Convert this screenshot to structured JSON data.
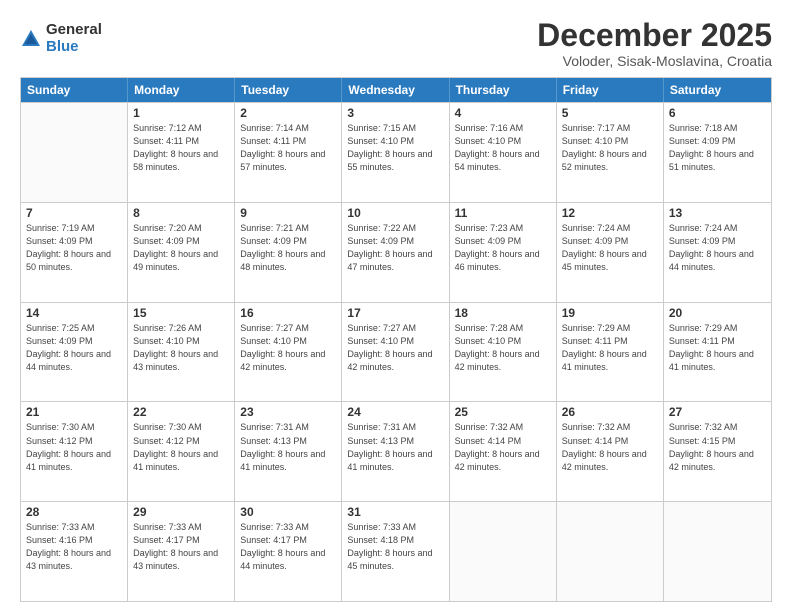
{
  "logo": {
    "general": "General",
    "blue": "Blue"
  },
  "title": "December 2025",
  "subtitle": "Voloder, Sisak-Moslavina, Croatia",
  "header_days": [
    "Sunday",
    "Monday",
    "Tuesday",
    "Wednesday",
    "Thursday",
    "Friday",
    "Saturday"
  ],
  "weeks": [
    [
      {
        "day": "",
        "sunrise": "",
        "sunset": "",
        "daylight": ""
      },
      {
        "day": "1",
        "sunrise": "Sunrise: 7:12 AM",
        "sunset": "Sunset: 4:11 PM",
        "daylight": "Daylight: 8 hours and 58 minutes."
      },
      {
        "day": "2",
        "sunrise": "Sunrise: 7:14 AM",
        "sunset": "Sunset: 4:11 PM",
        "daylight": "Daylight: 8 hours and 57 minutes."
      },
      {
        "day": "3",
        "sunrise": "Sunrise: 7:15 AM",
        "sunset": "Sunset: 4:10 PM",
        "daylight": "Daylight: 8 hours and 55 minutes."
      },
      {
        "day": "4",
        "sunrise": "Sunrise: 7:16 AM",
        "sunset": "Sunset: 4:10 PM",
        "daylight": "Daylight: 8 hours and 54 minutes."
      },
      {
        "day": "5",
        "sunrise": "Sunrise: 7:17 AM",
        "sunset": "Sunset: 4:10 PM",
        "daylight": "Daylight: 8 hours and 52 minutes."
      },
      {
        "day": "6",
        "sunrise": "Sunrise: 7:18 AM",
        "sunset": "Sunset: 4:09 PM",
        "daylight": "Daylight: 8 hours and 51 minutes."
      }
    ],
    [
      {
        "day": "7",
        "sunrise": "Sunrise: 7:19 AM",
        "sunset": "Sunset: 4:09 PM",
        "daylight": "Daylight: 8 hours and 50 minutes."
      },
      {
        "day": "8",
        "sunrise": "Sunrise: 7:20 AM",
        "sunset": "Sunset: 4:09 PM",
        "daylight": "Daylight: 8 hours and 49 minutes."
      },
      {
        "day": "9",
        "sunrise": "Sunrise: 7:21 AM",
        "sunset": "Sunset: 4:09 PM",
        "daylight": "Daylight: 8 hours and 48 minutes."
      },
      {
        "day": "10",
        "sunrise": "Sunrise: 7:22 AM",
        "sunset": "Sunset: 4:09 PM",
        "daylight": "Daylight: 8 hours and 47 minutes."
      },
      {
        "day": "11",
        "sunrise": "Sunrise: 7:23 AM",
        "sunset": "Sunset: 4:09 PM",
        "daylight": "Daylight: 8 hours and 46 minutes."
      },
      {
        "day": "12",
        "sunrise": "Sunrise: 7:24 AM",
        "sunset": "Sunset: 4:09 PM",
        "daylight": "Daylight: 8 hours and 45 minutes."
      },
      {
        "day": "13",
        "sunrise": "Sunrise: 7:24 AM",
        "sunset": "Sunset: 4:09 PM",
        "daylight": "Daylight: 8 hours and 44 minutes."
      }
    ],
    [
      {
        "day": "14",
        "sunrise": "Sunrise: 7:25 AM",
        "sunset": "Sunset: 4:09 PM",
        "daylight": "Daylight: 8 hours and 44 minutes."
      },
      {
        "day": "15",
        "sunrise": "Sunrise: 7:26 AM",
        "sunset": "Sunset: 4:10 PM",
        "daylight": "Daylight: 8 hours and 43 minutes."
      },
      {
        "day": "16",
        "sunrise": "Sunrise: 7:27 AM",
        "sunset": "Sunset: 4:10 PM",
        "daylight": "Daylight: 8 hours and 42 minutes."
      },
      {
        "day": "17",
        "sunrise": "Sunrise: 7:27 AM",
        "sunset": "Sunset: 4:10 PM",
        "daylight": "Daylight: 8 hours and 42 minutes."
      },
      {
        "day": "18",
        "sunrise": "Sunrise: 7:28 AM",
        "sunset": "Sunset: 4:10 PM",
        "daylight": "Daylight: 8 hours and 42 minutes."
      },
      {
        "day": "19",
        "sunrise": "Sunrise: 7:29 AM",
        "sunset": "Sunset: 4:11 PM",
        "daylight": "Daylight: 8 hours and 41 minutes."
      },
      {
        "day": "20",
        "sunrise": "Sunrise: 7:29 AM",
        "sunset": "Sunset: 4:11 PM",
        "daylight": "Daylight: 8 hours and 41 minutes."
      }
    ],
    [
      {
        "day": "21",
        "sunrise": "Sunrise: 7:30 AM",
        "sunset": "Sunset: 4:12 PM",
        "daylight": "Daylight: 8 hours and 41 minutes."
      },
      {
        "day": "22",
        "sunrise": "Sunrise: 7:30 AM",
        "sunset": "Sunset: 4:12 PM",
        "daylight": "Daylight: 8 hours and 41 minutes."
      },
      {
        "day": "23",
        "sunrise": "Sunrise: 7:31 AM",
        "sunset": "Sunset: 4:13 PM",
        "daylight": "Daylight: 8 hours and 41 minutes."
      },
      {
        "day": "24",
        "sunrise": "Sunrise: 7:31 AM",
        "sunset": "Sunset: 4:13 PM",
        "daylight": "Daylight: 8 hours and 41 minutes."
      },
      {
        "day": "25",
        "sunrise": "Sunrise: 7:32 AM",
        "sunset": "Sunset: 4:14 PM",
        "daylight": "Daylight: 8 hours and 42 minutes."
      },
      {
        "day": "26",
        "sunrise": "Sunrise: 7:32 AM",
        "sunset": "Sunset: 4:14 PM",
        "daylight": "Daylight: 8 hours and 42 minutes."
      },
      {
        "day": "27",
        "sunrise": "Sunrise: 7:32 AM",
        "sunset": "Sunset: 4:15 PM",
        "daylight": "Daylight: 8 hours and 42 minutes."
      }
    ],
    [
      {
        "day": "28",
        "sunrise": "Sunrise: 7:33 AM",
        "sunset": "Sunset: 4:16 PM",
        "daylight": "Daylight: 8 hours and 43 minutes."
      },
      {
        "day": "29",
        "sunrise": "Sunrise: 7:33 AM",
        "sunset": "Sunset: 4:17 PM",
        "daylight": "Daylight: 8 hours and 43 minutes."
      },
      {
        "day": "30",
        "sunrise": "Sunrise: 7:33 AM",
        "sunset": "Sunset: 4:17 PM",
        "daylight": "Daylight: 8 hours and 44 minutes."
      },
      {
        "day": "31",
        "sunrise": "Sunrise: 7:33 AM",
        "sunset": "Sunset: 4:18 PM",
        "daylight": "Daylight: 8 hours and 45 minutes."
      },
      {
        "day": "",
        "sunrise": "",
        "sunset": "",
        "daylight": ""
      },
      {
        "day": "",
        "sunrise": "",
        "sunset": "",
        "daylight": ""
      },
      {
        "day": "",
        "sunrise": "",
        "sunset": "",
        "daylight": ""
      }
    ]
  ]
}
